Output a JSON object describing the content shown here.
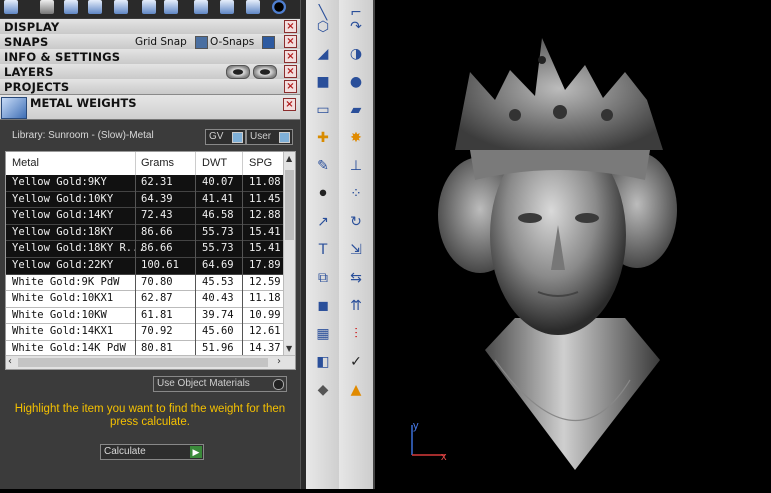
{
  "panels": {
    "display": "DISPLAY",
    "snaps": "SNAPS",
    "snaps_grid": "Grid Snap",
    "snaps_osnaps": "O-Snaps",
    "info_settings": "INFO & SETTINGS",
    "layers": "LAYERS",
    "projects": "PROJECTS",
    "close_glyph": "×"
  },
  "metal_weights": {
    "title": "METAL WEIGHTS",
    "library": "Library: Sunroom - (Slow)-Metal",
    "gv_label": "GV",
    "user_label": "User",
    "columns": [
      "Metal",
      "Grams",
      "DWT",
      "SPG"
    ],
    "rows": [
      [
        "Yellow Gold:9KY",
        "62.31",
        "40.07",
        "11.08"
      ],
      [
        "Yellow Gold:10KY",
        "64.39",
        "41.41",
        "11.45"
      ],
      [
        "Yellow Gold:14KY",
        "72.43",
        "46.58",
        "12.88"
      ],
      [
        "Yellow Gold:18KY",
        "86.66",
        "55.73",
        "15.41"
      ],
      [
        "Yellow Gold:18KY R...",
        "86.66",
        "55.73",
        "15.41"
      ],
      [
        "Yellow Gold:22KY",
        "100.61",
        "64.69",
        "17.89"
      ],
      [
        "White Gold:9K PdW",
        "70.80",
        "45.53",
        "12.59"
      ],
      [
        "White Gold:10KX1",
        "62.87",
        "40.43",
        "11.18"
      ],
      [
        "White Gold:10KW",
        "61.81",
        "39.74",
        "10.99"
      ],
      [
        "White Gold:14KX1",
        "70.92",
        "45.60",
        "12.61"
      ],
      [
        "White Gold:14K PdW",
        "80.81",
        "51.96",
        "14.37"
      ]
    ],
    "use_object_materials": "Use Object Materials",
    "hint": "Highlight the item you want to find the weight for then press calculate.",
    "calculate_label": "Calculate"
  },
  "viewport": {
    "axis_y": "y",
    "axis_x": "x"
  }
}
